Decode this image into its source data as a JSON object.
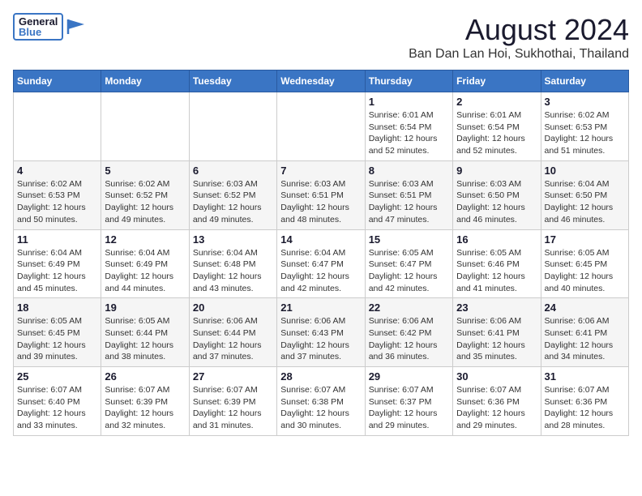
{
  "header": {
    "logo_general": "General",
    "logo_blue": "Blue",
    "month_year": "August 2024",
    "location": "Ban Dan Lan Hoi, Sukhothai, Thailand"
  },
  "weekdays": [
    "Sunday",
    "Monday",
    "Tuesday",
    "Wednesday",
    "Thursday",
    "Friday",
    "Saturday"
  ],
  "weeks": [
    [
      {
        "day": "",
        "info": ""
      },
      {
        "day": "",
        "info": ""
      },
      {
        "day": "",
        "info": ""
      },
      {
        "day": "",
        "info": ""
      },
      {
        "day": "1",
        "info": "Sunrise: 6:01 AM\nSunset: 6:54 PM\nDaylight: 12 hours\nand 52 minutes."
      },
      {
        "day": "2",
        "info": "Sunrise: 6:01 AM\nSunset: 6:54 PM\nDaylight: 12 hours\nand 52 minutes."
      },
      {
        "day": "3",
        "info": "Sunrise: 6:02 AM\nSunset: 6:53 PM\nDaylight: 12 hours\nand 51 minutes."
      }
    ],
    [
      {
        "day": "4",
        "info": "Sunrise: 6:02 AM\nSunset: 6:53 PM\nDaylight: 12 hours\nand 50 minutes."
      },
      {
        "day": "5",
        "info": "Sunrise: 6:02 AM\nSunset: 6:52 PM\nDaylight: 12 hours\nand 49 minutes."
      },
      {
        "day": "6",
        "info": "Sunrise: 6:03 AM\nSunset: 6:52 PM\nDaylight: 12 hours\nand 49 minutes."
      },
      {
        "day": "7",
        "info": "Sunrise: 6:03 AM\nSunset: 6:51 PM\nDaylight: 12 hours\nand 48 minutes."
      },
      {
        "day": "8",
        "info": "Sunrise: 6:03 AM\nSunset: 6:51 PM\nDaylight: 12 hours\nand 47 minutes."
      },
      {
        "day": "9",
        "info": "Sunrise: 6:03 AM\nSunset: 6:50 PM\nDaylight: 12 hours\nand 46 minutes."
      },
      {
        "day": "10",
        "info": "Sunrise: 6:04 AM\nSunset: 6:50 PM\nDaylight: 12 hours\nand 46 minutes."
      }
    ],
    [
      {
        "day": "11",
        "info": "Sunrise: 6:04 AM\nSunset: 6:49 PM\nDaylight: 12 hours\nand 45 minutes."
      },
      {
        "day": "12",
        "info": "Sunrise: 6:04 AM\nSunset: 6:49 PM\nDaylight: 12 hours\nand 44 minutes."
      },
      {
        "day": "13",
        "info": "Sunrise: 6:04 AM\nSunset: 6:48 PM\nDaylight: 12 hours\nand 43 minutes."
      },
      {
        "day": "14",
        "info": "Sunrise: 6:04 AM\nSunset: 6:47 PM\nDaylight: 12 hours\nand 42 minutes."
      },
      {
        "day": "15",
        "info": "Sunrise: 6:05 AM\nSunset: 6:47 PM\nDaylight: 12 hours\nand 42 minutes."
      },
      {
        "day": "16",
        "info": "Sunrise: 6:05 AM\nSunset: 6:46 PM\nDaylight: 12 hours\nand 41 minutes."
      },
      {
        "day": "17",
        "info": "Sunrise: 6:05 AM\nSunset: 6:45 PM\nDaylight: 12 hours\nand 40 minutes."
      }
    ],
    [
      {
        "day": "18",
        "info": "Sunrise: 6:05 AM\nSunset: 6:45 PM\nDaylight: 12 hours\nand 39 minutes."
      },
      {
        "day": "19",
        "info": "Sunrise: 6:05 AM\nSunset: 6:44 PM\nDaylight: 12 hours\nand 38 minutes."
      },
      {
        "day": "20",
        "info": "Sunrise: 6:06 AM\nSunset: 6:44 PM\nDaylight: 12 hours\nand 37 minutes."
      },
      {
        "day": "21",
        "info": "Sunrise: 6:06 AM\nSunset: 6:43 PM\nDaylight: 12 hours\nand 37 minutes."
      },
      {
        "day": "22",
        "info": "Sunrise: 6:06 AM\nSunset: 6:42 PM\nDaylight: 12 hours\nand 36 minutes."
      },
      {
        "day": "23",
        "info": "Sunrise: 6:06 AM\nSunset: 6:41 PM\nDaylight: 12 hours\nand 35 minutes."
      },
      {
        "day": "24",
        "info": "Sunrise: 6:06 AM\nSunset: 6:41 PM\nDaylight: 12 hours\nand 34 minutes."
      }
    ],
    [
      {
        "day": "25",
        "info": "Sunrise: 6:07 AM\nSunset: 6:40 PM\nDaylight: 12 hours\nand 33 minutes."
      },
      {
        "day": "26",
        "info": "Sunrise: 6:07 AM\nSunset: 6:39 PM\nDaylight: 12 hours\nand 32 minutes."
      },
      {
        "day": "27",
        "info": "Sunrise: 6:07 AM\nSunset: 6:39 PM\nDaylight: 12 hours\nand 31 minutes."
      },
      {
        "day": "28",
        "info": "Sunrise: 6:07 AM\nSunset: 6:38 PM\nDaylight: 12 hours\nand 30 minutes."
      },
      {
        "day": "29",
        "info": "Sunrise: 6:07 AM\nSunset: 6:37 PM\nDaylight: 12 hours\nand 29 minutes."
      },
      {
        "day": "30",
        "info": "Sunrise: 6:07 AM\nSunset: 6:36 PM\nDaylight: 12 hours\nand 29 minutes."
      },
      {
        "day": "31",
        "info": "Sunrise: 6:07 AM\nSunset: 6:36 PM\nDaylight: 12 hours\nand 28 minutes."
      }
    ]
  ]
}
